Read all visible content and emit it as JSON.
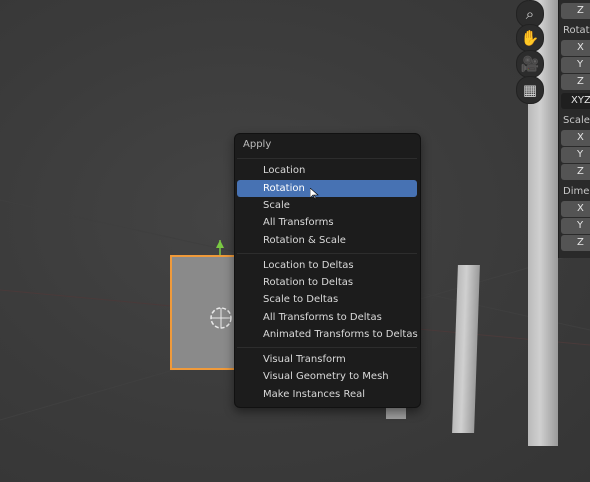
{
  "menu": {
    "title": "Apply",
    "groups": [
      [
        "Location",
        "Rotation",
        "Scale",
        "All Transforms",
        "Rotation & Scale"
      ],
      [
        "Location to Deltas",
        "Rotation to Deltas",
        "Scale to Deltas",
        "All Transforms to Deltas",
        "Animated Transforms to Deltas"
      ],
      [
        "Visual Transform",
        "Visual Geometry to Mesh",
        "Make Instances Real"
      ]
    ],
    "highlighted": "Rotation"
  },
  "side_panel": {
    "top_field": "Z",
    "rotation_label": "Rotation",
    "rotation_fields": [
      "X",
      "Y",
      "Z"
    ],
    "rotation_mode": "XYZ",
    "scale_label": "Scale:",
    "scale_fields": [
      "X",
      "Y",
      "Z"
    ],
    "dimensions_label": "Dimen",
    "dimensions_fields": [
      "X",
      "Y",
      "Z"
    ]
  },
  "nav_icons": [
    "zoom-icon",
    "hand-pan-icon",
    "camera-icon",
    "grid-perspective-icon"
  ],
  "colors": {
    "highlight": "#4772b3",
    "selection_outline": "#f09a3a",
    "menu_bg": "#1c1c1c"
  }
}
